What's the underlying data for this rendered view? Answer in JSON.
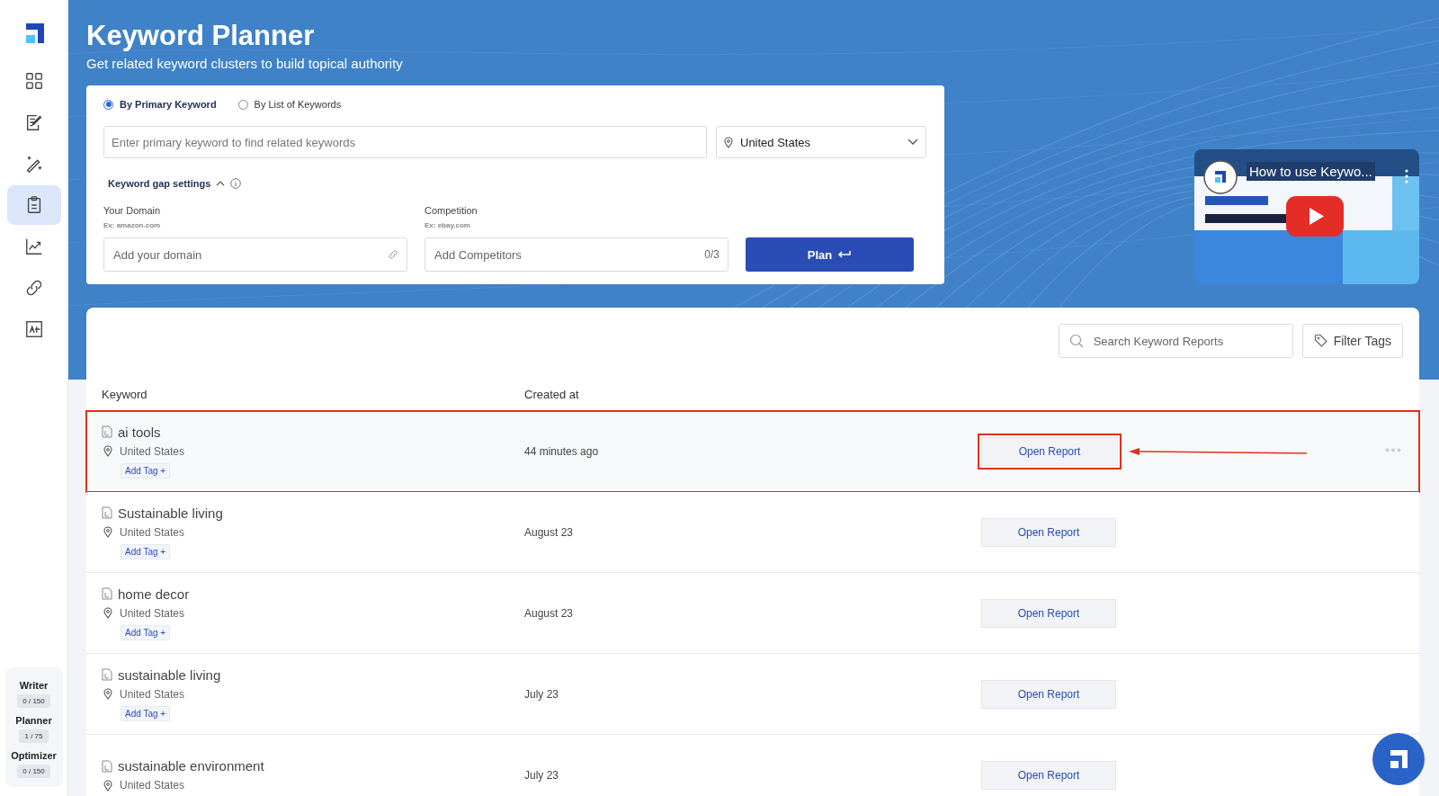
{
  "sidebar": {
    "items": [
      {
        "selected": false
      },
      {
        "selected": false
      },
      {
        "selected": false
      },
      {
        "selected": true
      },
      {
        "selected": false
      },
      {
        "selected": false
      },
      {
        "selected": false
      }
    ],
    "usage": [
      {
        "label": "Writer",
        "value": "0 / 150"
      },
      {
        "label": "Planner",
        "value": "1 / 75"
      },
      {
        "label": "Optimizer",
        "value": "0 / 150"
      }
    ]
  },
  "header": {
    "title": "Keyword Planner",
    "subtitle": "Get related keyword clusters to build topical authority"
  },
  "form": {
    "modes": [
      {
        "label": "By Primary Keyword",
        "selected": true
      },
      {
        "label": "By List of Keywords",
        "selected": false
      }
    ],
    "keyword": {
      "placeholder": "Enter primary keyword to find related keywords"
    },
    "country": "United States",
    "gap_settings": "Keyword gap settings",
    "domain": {
      "label": "Your Domain",
      "hint": "Ex: amazon.com",
      "placeholder": "Add your domain"
    },
    "competition": {
      "label": "Competition",
      "hint": "Ex: ebay.com",
      "placeholder": "Add Competitors",
      "count": "0/3"
    },
    "plan_button": "Plan"
  },
  "video": {
    "title": "How to use Keywo..."
  },
  "reports": {
    "search": {
      "placeholder": "Search Keyword Reports"
    },
    "filter_button": "Filter Tags",
    "columns": [
      "Keyword",
      "Created at"
    ],
    "rows": [
      {
        "keyword": "ai tools",
        "country": "United States",
        "tag_button": "Add Tag +",
        "created": "44 minutes ago",
        "action": "Open Report",
        "annotated": true
      },
      {
        "keyword": "Sustainable living",
        "country": "United States",
        "tag_button": "Add Tag +",
        "created": "August 23",
        "action": "Open Report",
        "annotated": false
      },
      {
        "keyword": "home decor",
        "country": "United States",
        "tag_button": "Add Tag +",
        "created": "August 23",
        "action": "Open Report",
        "annotated": false
      },
      {
        "keyword": "sustainable living",
        "country": "United States",
        "tag_button": "Add Tag +",
        "created": "July 23",
        "action": "Open Report",
        "annotated": false
      },
      {
        "keyword": "sustainable environment",
        "country": "United States",
        "created": "July 23",
        "action": "Open Report",
        "annotated": false
      }
    ]
  }
}
